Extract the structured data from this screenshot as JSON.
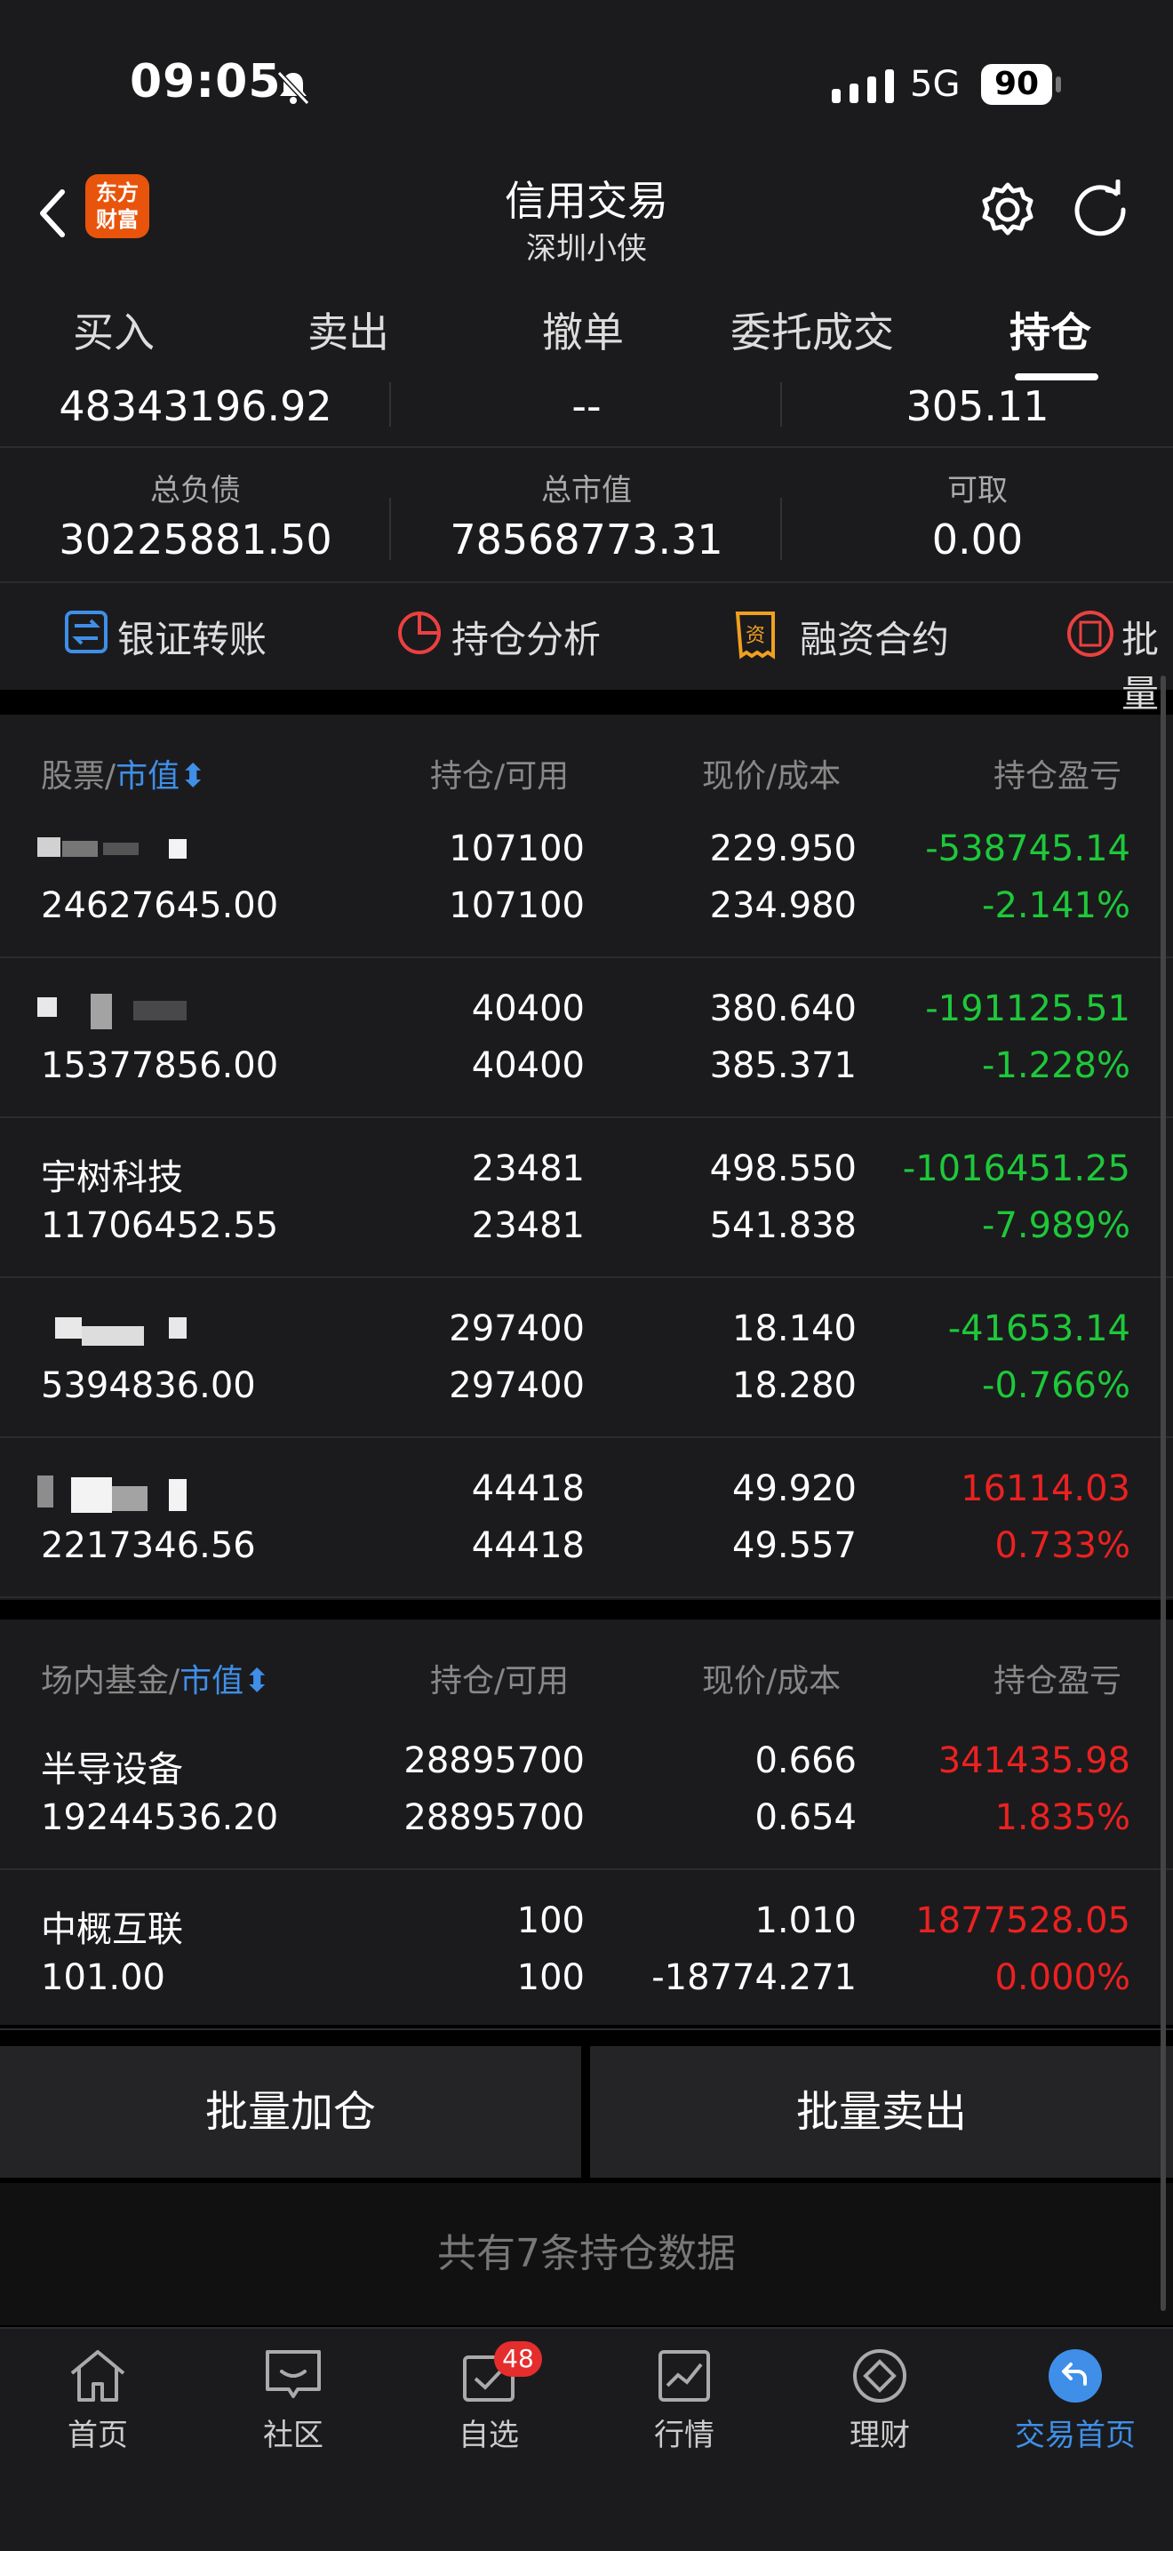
{
  "status_bar": {
    "time": "09:05",
    "network": "5G",
    "battery": "90"
  },
  "header": {
    "logo_text_line1": "东方",
    "logo_text_line2": "财富",
    "title": "信用交易",
    "subtitle": "深圳小侠"
  },
  "tabs": [
    {
      "label": "买入"
    },
    {
      "label": "卖出"
    },
    {
      "label": "撤单"
    },
    {
      "label": "委托成交"
    },
    {
      "label": "持仓"
    }
  ],
  "summary": {
    "row1": {
      "a": "48343196.92",
      "b": "--",
      "c": "305.11"
    },
    "row2": [
      {
        "label": "总负债",
        "value": "30225881.50"
      },
      {
        "label": "总市值",
        "value": "78568773.31"
      },
      {
        "label": "可取",
        "value": "0.00"
      }
    ]
  },
  "quick_actions": [
    {
      "label": "银证转账",
      "icon": "transfer-icon"
    },
    {
      "label": "持仓分析",
      "icon": "pie-chart-icon"
    },
    {
      "label": "融资合约",
      "icon": "contract-icon"
    },
    {
      "label": "批量",
      "icon": "batch-icon"
    }
  ],
  "stock_table": {
    "headers": {
      "name": "股票",
      "sort": "市值",
      "hold": "持仓",
      "avail": "可用",
      "price": "现价",
      "cost": "成本",
      "pl": "持仓盈亏"
    },
    "rows": [
      {
        "name": "",
        "value": "24627645.00",
        "hold": "107100",
        "avail": "107100",
        "price": "229.950",
        "cost": "234.980",
        "pl": "-538745.14",
        "pl_pct": "-2.141%",
        "dir": "down"
      },
      {
        "name": "",
        "value": "15377856.00",
        "hold": "40400",
        "avail": "40400",
        "price": "380.640",
        "cost": "385.371",
        "pl": "-191125.51",
        "pl_pct": "-1.228%",
        "dir": "down"
      },
      {
        "name": "宇树科技",
        "value": "11706452.55",
        "hold": "23481",
        "avail": "23481",
        "price": "498.550",
        "cost": "541.838",
        "pl": "-1016451.25",
        "pl_pct": "-7.989%",
        "dir": "down"
      },
      {
        "name": "",
        "value": "5394836.00",
        "hold": "297400",
        "avail": "297400",
        "price": "18.140",
        "cost": "18.280",
        "pl": "-41653.14",
        "pl_pct": "-0.766%",
        "dir": "down"
      },
      {
        "name": "",
        "value": "2217346.56",
        "hold": "44418",
        "avail": "44418",
        "price": "49.920",
        "cost": "49.557",
        "pl": "16114.03",
        "pl_pct": "0.733%",
        "dir": "up"
      }
    ]
  },
  "fund_table": {
    "headers": {
      "name": "场内基金",
      "sort": "市值",
      "hold": "持仓",
      "avail": "可用",
      "price": "现价",
      "cost": "成本",
      "pl": "持仓盈亏"
    },
    "rows": [
      {
        "name": "半导设备",
        "value": "19244536.20",
        "hold": "28895700",
        "avail": "28895700",
        "price": "0.666",
        "cost": "0.654",
        "pl": "341435.98",
        "pl_pct": "1.835%",
        "dir": "up"
      },
      {
        "name": "中概互联",
        "value": "101.00",
        "hold": "100",
        "avail": "100",
        "price": "1.010",
        "cost": "-18774.271",
        "pl": "1877528.05",
        "pl_pct": "0.000%",
        "dir": "up"
      }
    ]
  },
  "buttons": {
    "batch_add": "批量加仓",
    "batch_sell": "批量卖出"
  },
  "footer_message": "共有7条持仓数据",
  "bottom_nav": [
    {
      "label": "首页",
      "icon": "home-icon"
    },
    {
      "label": "社区",
      "icon": "community-icon"
    },
    {
      "label": "自选",
      "icon": "watchlist-icon",
      "badge": "48"
    },
    {
      "label": "行情",
      "icon": "market-icon"
    },
    {
      "label": "理财",
      "icon": "wealth-icon"
    },
    {
      "label": "交易首页",
      "icon": "trade-home-icon",
      "active": true
    }
  ],
  "colors": {
    "down": "#1ec83a",
    "up": "#ec2121",
    "accent": "#3f8fe8",
    "logo": "#e8540c"
  }
}
